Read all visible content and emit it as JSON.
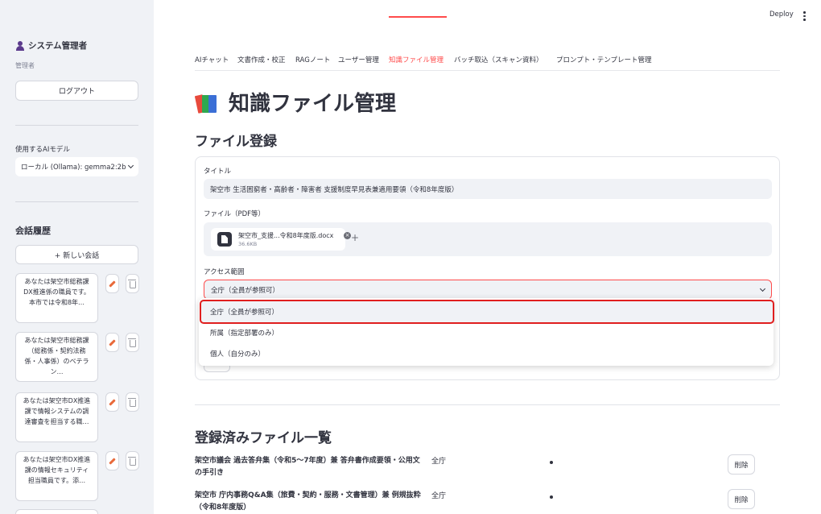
{
  "sidebar": {
    "user_name": "システム管理者",
    "role": "管理者",
    "logout_label": "ログアウト",
    "model_label": "使用するAIモデル",
    "model_value": "ローカル (Ollama): gemma2:2b",
    "history_title": "会話履歴",
    "new_chat_label": "+ 新しい会話",
    "history": [
      {
        "text": "あなたは架空市総務課DX推進係の職員です。本市では令和8年…"
      },
      {
        "text": "あなたは架空市総務課（総務係・契約法務係・人事係）のベテラン…"
      },
      {
        "text": "あなたは架空市DX推進課で情報システムの調達審査を担当する職…"
      },
      {
        "text": "あなたは架空市DX推進課の情報セキュリティ担当職員です。添…"
      }
    ]
  },
  "header": {
    "deploy_label": "Deploy"
  },
  "tabs": [
    {
      "label": "AIチャット"
    },
    {
      "label": "文書作成・校正"
    },
    {
      "label": "RAGノート"
    },
    {
      "label": "ユーザー管理"
    },
    {
      "label": "知識ファイル管理"
    },
    {
      "label": "バッチ取込（スキャン資料）"
    },
    {
      "label": "プロンプト・テンプレート管理"
    }
  ],
  "active_tab": "知識ファイル管理",
  "page_title": "知識ファイル管理",
  "register": {
    "title": "ファイル登録",
    "title_label": "タイトル",
    "title_value": "架空市 生活困窮者・高齢者・障害者 支援制度早見表兼適用要領（令和8年度版）",
    "file_label": "ファイル（PDF等）",
    "file_name": "架空市_支援...令和8年度版.docx",
    "file_size": "36.6KB",
    "scope_label": "アクセス範囲",
    "scope_value": "全庁（全員が参照可）",
    "scope_options": [
      {
        "label": "全庁（全員が参照可）"
      },
      {
        "label": "所属（指定部署のみ）"
      },
      {
        "label": "個人（自分のみ）"
      }
    ]
  },
  "list": {
    "title": "登録済みファイル一覧",
    "delete_label": "削除",
    "rows": [
      {
        "title": "架空市議会 過去答弁集（令和5〜7年度）兼 答弁書作成要領・公用文の手引き",
        "scope": "全庁"
      },
      {
        "title": "架空市 庁内事務Q&A集（旅費・契約・服務・文書管理）兼 例規抜粋（令和8年度版）",
        "scope": "全庁"
      }
    ]
  },
  "colors": {
    "accent": "#ff4b4b",
    "highlight": "#e01f1f",
    "sidebar_bg": "#f0f2f6"
  }
}
